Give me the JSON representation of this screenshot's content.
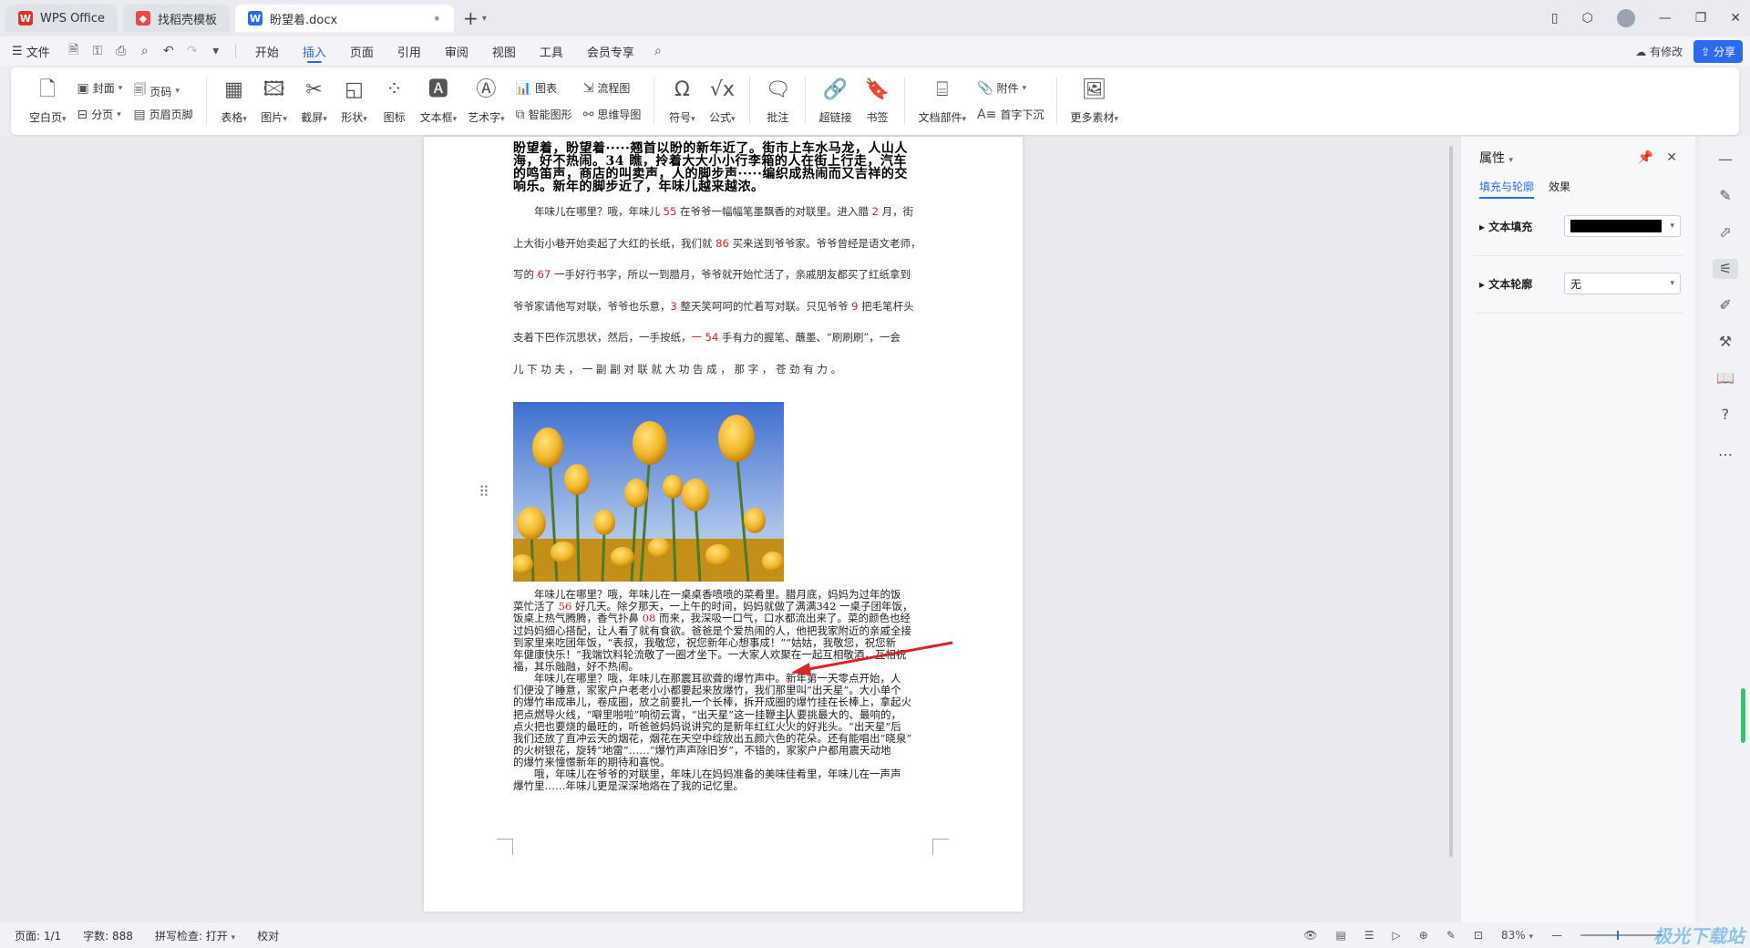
{
  "tabs": [
    {
      "label": "WPS Office",
      "icon": "wps-logo"
    },
    {
      "label": "找稻壳模板",
      "icon": "docer-logo"
    },
    {
      "label": "盼望着.docx",
      "icon": "word-doc-icon"
    }
  ],
  "menu": {
    "file": "文件",
    "items": [
      "开始",
      "插入",
      "页面",
      "引用",
      "审阅",
      "视图",
      "工具",
      "会员专享"
    ],
    "active": "插入",
    "modified": "有修改",
    "share": "分享"
  },
  "ribbon": {
    "blank_page": "空白页",
    "cover": "封面",
    "page_break": "分页",
    "page_number": "页码",
    "header_footer": "页眉页脚",
    "table": "表格",
    "picture": "图片",
    "screenshot": "截屏",
    "shape": "形状",
    "icon": "图标",
    "textbox": "文本框",
    "wordart": "艺术字",
    "chart": "图表",
    "smart_shape": "智能图形",
    "flowchart": "流程图",
    "mindmap": "思维导图",
    "symbol": "符号",
    "formula": "公式",
    "comment": "批注",
    "hyperlink": "超链接",
    "bookmark": "书签",
    "doc_parts": "文档部件",
    "attachment": "附件",
    "drop_cap": "首字下沉",
    "more": "更多素材"
  },
  "document": {
    "title_lines": [
      "盼望着，盼望着·····翘首以盼的新年近了。街市上车水马龙，人山人",
      "海，好不热闹。34 瞧，拎着大大小小行李箱的人在街上行走，汽车",
      "的鸣笛声，商店的叫卖声，人的脚步声·····编织成热闹而又吉祥的交",
      "响乐。新年的脚步近了，年味儿越来越浓。"
    ],
    "para1": [
      [
        "　　年味儿在哪里？哦，年味儿 ",
        "55",
        " 在爷爷一幅幅笔墨飘香的对联里。进入腊 ",
        "2",
        " 月，街"
      ],
      [
        "上大街小巷开始卖起了大红的长纸，我们就 ",
        "86",
        " 买来送到爷爷家。爷爷曾经是语文老师，",
        "",
        ""
      ],
      [
        "写的 ",
        "67",
        " 一手好行书字，所以一到腊月，爷爷就开始忙活了，亲戚朋友都买了红纸拿到",
        "",
        ""
      ],
      [
        "爷爷家请他写对联，爷爷也乐意，",
        "3",
        " 整天笑呵呵的忙着写对联。只见爷爷 ",
        "9",
        " 把毛笔杆头"
      ],
      [
        "支着下巴作沉思状，然后，一手按纸，",
        "一 54",
        " 手有力的握笔、蘸墨、“刷刷刷”，一会",
        "",
        ""
      ],
      [
        "儿 下 功 夫 ， 一 副 副 对 联 就 大 功 告 成 ， 那 字 ， 苍 劲 有 力 。",
        "",
        "",
        "",
        ""
      ]
    ],
    "para2": [
      [
        "　　年味儿在哪里？哦，年味儿在一桌桌香喷喷的菜肴里。腊月底，妈妈为过年的饭",
        "",
        ""
      ],
      [
        "菜忙活了 ",
        "56",
        " 好几天。除夕那天，一上午的时间，妈妈就做了满满342 一桌子团年饭，"
      ],
      [
        "饭桌上热气腾腾，香气扑鼻 ",
        "08",
        " 而来，我深吸一口气，口水都流出来了。菜的颜色也经"
      ],
      [
        "过妈妈细心搭配，让人看了就有食欲。爸爸是个爱热闹的人，他把我家附近的亲戚全接",
        "",
        ""
      ],
      [
        "到家里来吃团年饭，“表叔，我敬您，祝您新年心想事成！”“姑姑，我敬您，祝您新",
        "",
        ""
      ],
      [
        "年健康快乐！”我端饮料轮流敬了一圈才坐下。一大家人欢聚在一起互相敬酒，互相祝",
        "",
        ""
      ],
      [
        "福，其乐融融，好不热闹。",
        "",
        ""
      ]
    ],
    "para3": [
      "　　年味儿在哪里？哦，年味儿在那震耳欲聋的爆竹声中。新年第一天零点开始，人",
      "们便没了睡意，家家户户老老小小都要起来放爆竹，我们那里叫“出天星”。大小单个",
      "的爆竹串成串儿，卷成圈，放之前要扎一个长棒，拆开成圈的爆竹挂在长棒上，拿起火",
      "把点燃导火线，“噼里啪啦”响彻云霄，“出天星”这一挂鞭主人要挑最大的、最响的，",
      "点火把也要烧的最旺的，听爸爸妈妈说讲究的是新年红红火火的好兆头。“出天星”后",
      "我们还放了直冲云天的烟花，烟花在天空中绽放出五颜六色的花朵。还有能唱出“晓泉”",
      "的火树银花，旋转“地雷”……“爆竹声声除旧岁”，不错的，家家户户都用震天动地",
      "的爆竹来憧憬新年的期待和喜悦。"
    ],
    "para4": [
      "　　哦，年味儿在爷爷的对联里，年味儿在妈妈准备的美味佳肴里，年味儿在一声声",
      "爆竹里……年味儿更是深深地烙在了我的记忆里。"
    ]
  },
  "properties": {
    "title": "属性",
    "tab_fill": "填充与轮廓",
    "tab_effect": "效果",
    "text_fill_label": "文本填充",
    "text_fill_color": "#000000",
    "text_outline_label": "文本轮廓",
    "text_outline_value": "无"
  },
  "status": {
    "page": "页面: 1/1",
    "words": "字数: 888",
    "spell": "拼写检查: 打开",
    "proof": "校对",
    "zoom": "83%"
  },
  "watermark": "极光下载站"
}
